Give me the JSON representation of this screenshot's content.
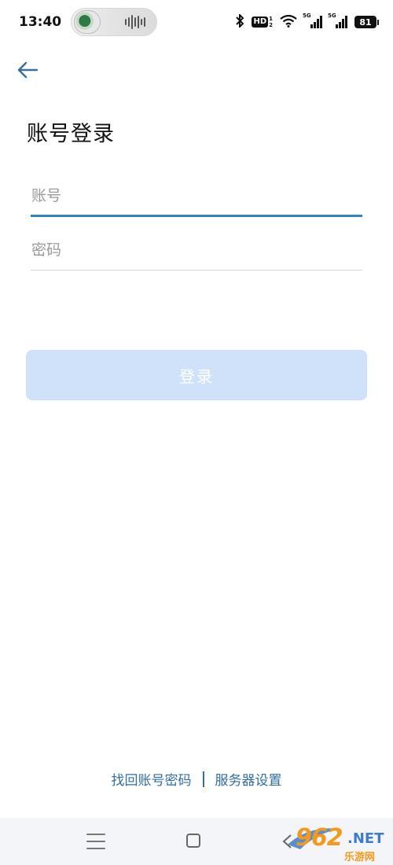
{
  "status_bar": {
    "time": "13:40",
    "signal_label": "5G",
    "signal_label_2": "5G",
    "hd_label": "HD",
    "hd_fraction_top": "1",
    "hd_fraction_bottom": "2",
    "battery": "81"
  },
  "header": {
    "title": "账号登录"
  },
  "form": {
    "account_placeholder": "账号",
    "account_value": "",
    "password_placeholder": "密码",
    "password_value": "",
    "login_label": "登录"
  },
  "footer": {
    "recover_label": "找回账号密码",
    "server_label": "服务器设置"
  },
  "watermark": {
    "number": "962",
    "domain": ".NET",
    "subtitle": "乐游网"
  },
  "colors": {
    "accent": "#2c86c4",
    "link": "#2f6fa2",
    "button_disabled": "#cfe2fa"
  }
}
